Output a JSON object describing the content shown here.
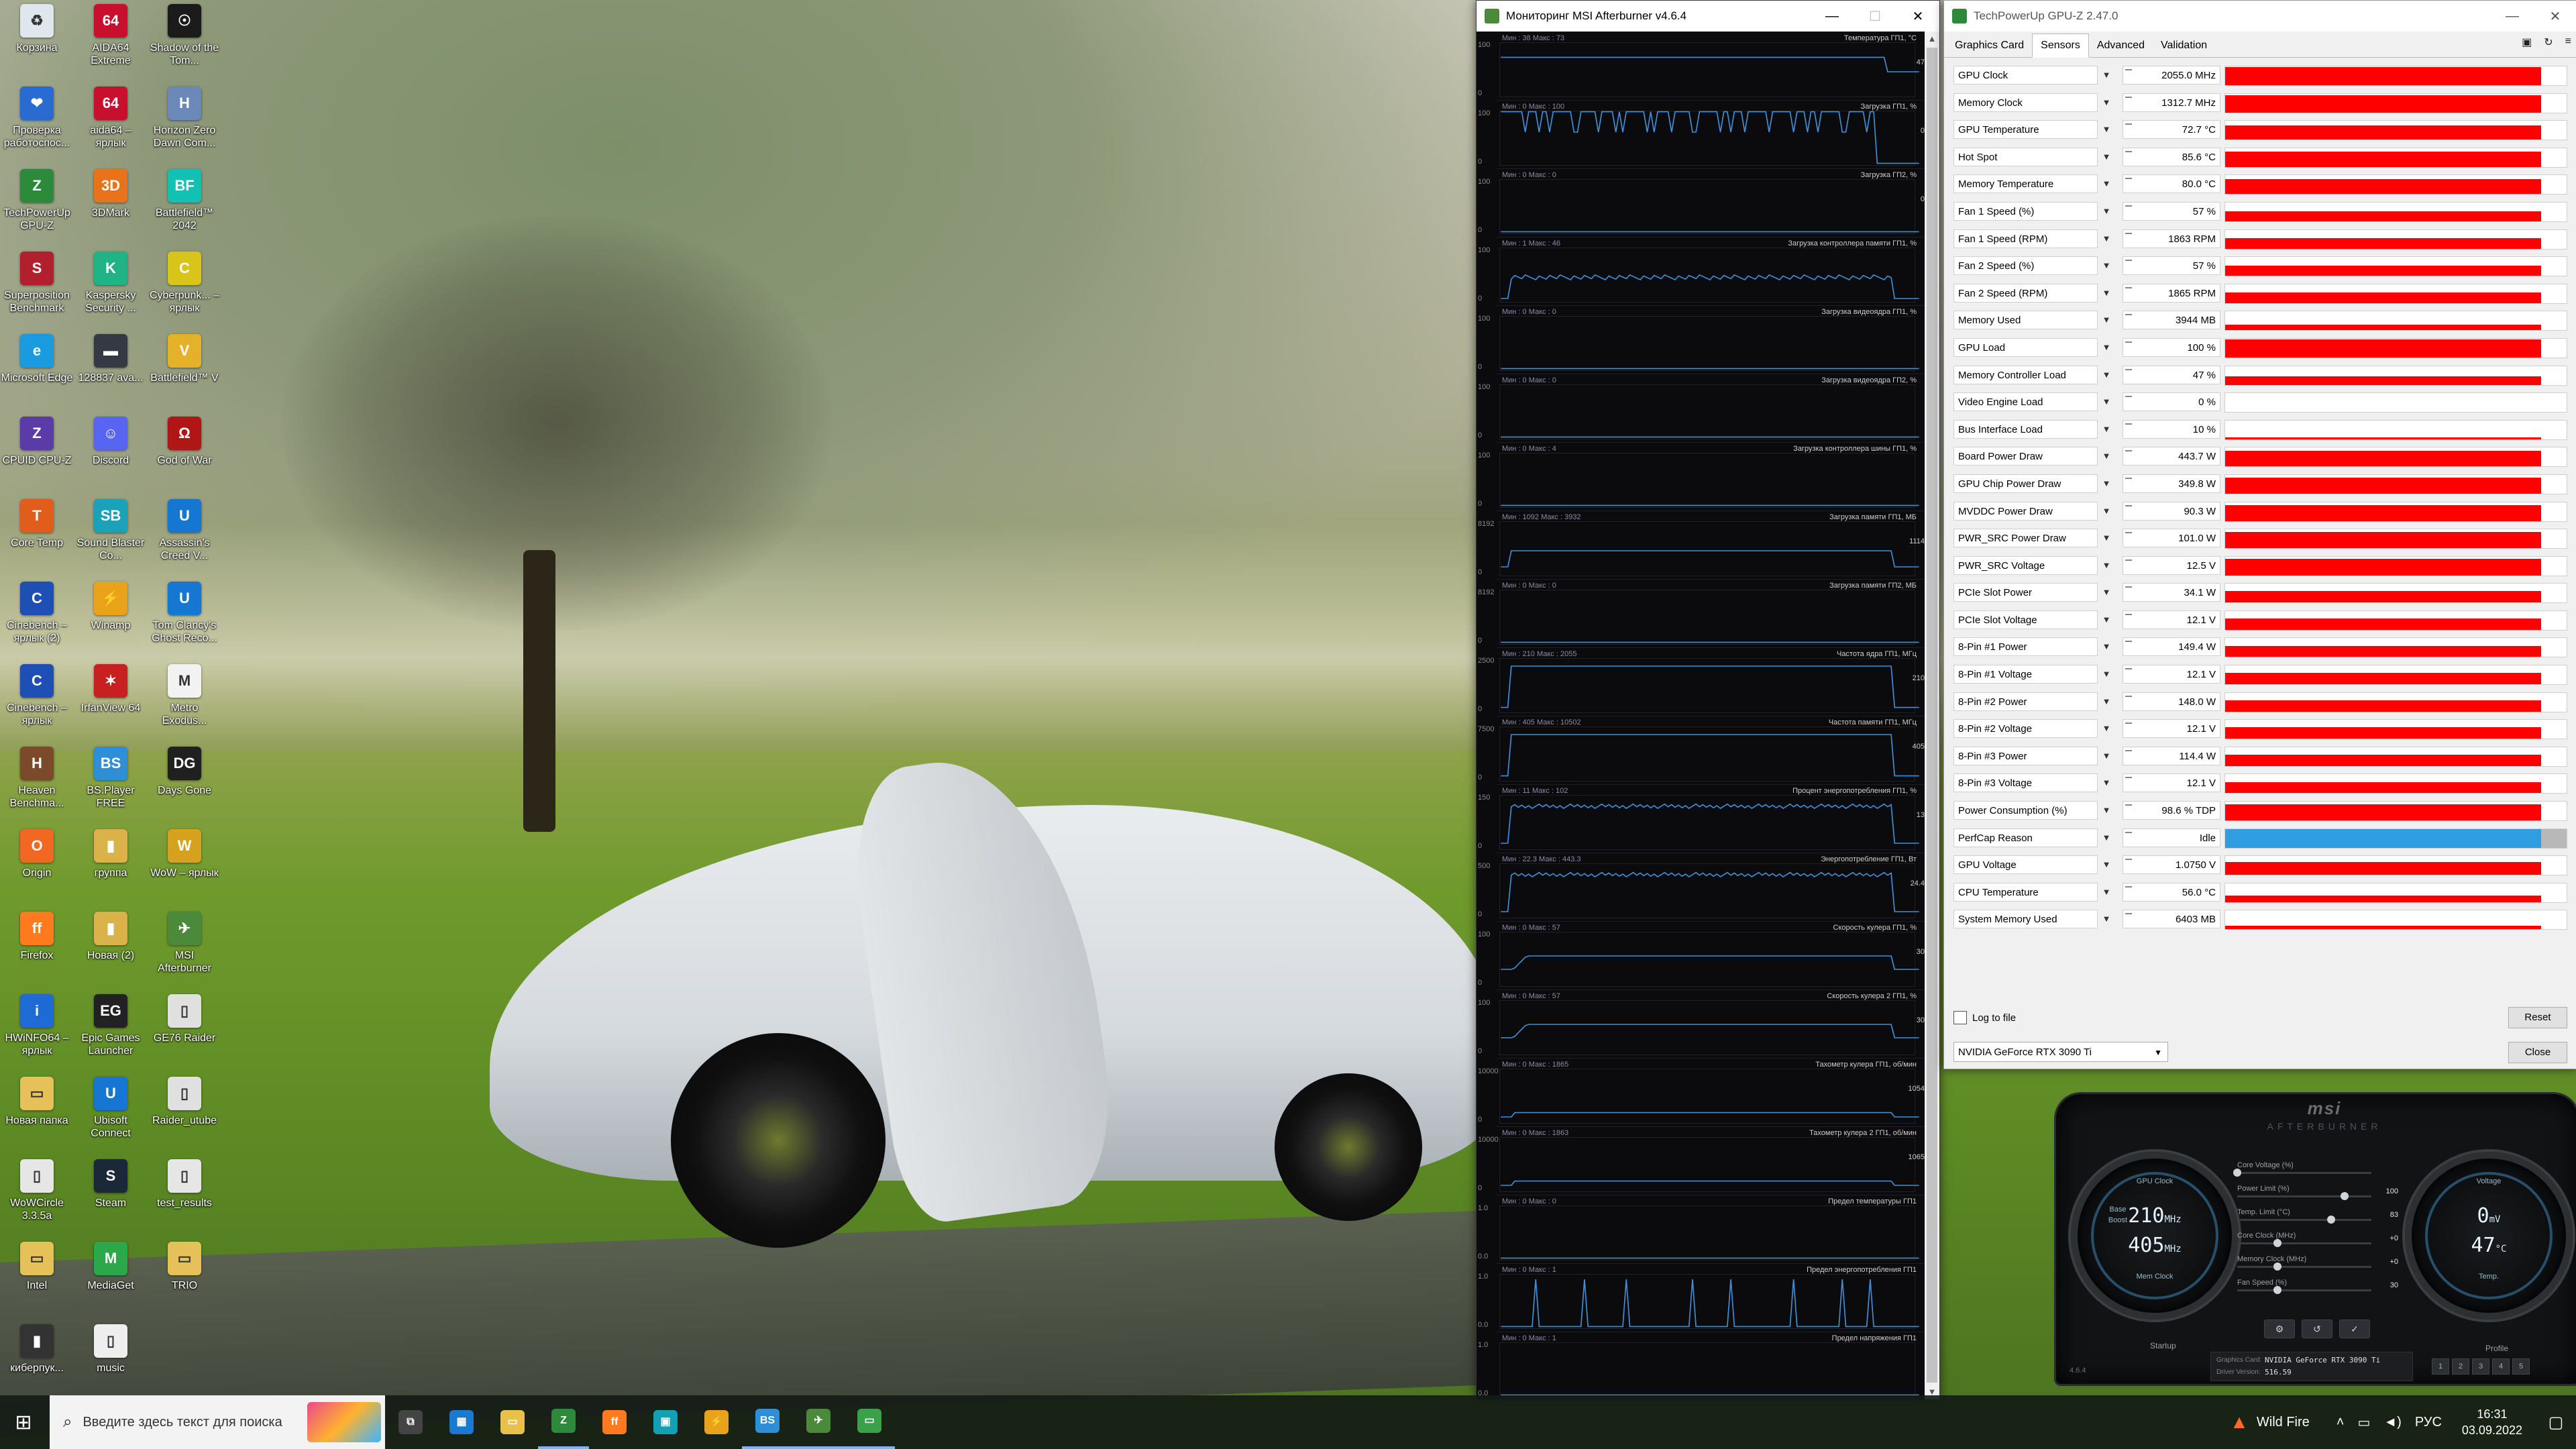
{
  "desktop": {
    "icons": [
      {
        "label": "Корзина",
        "color": "#dfe6ee",
        "symbol": "♻"
      },
      {
        "label": "AIDA64 Extreme",
        "color": "#c8102e",
        "symbol": "64"
      },
      {
        "label": "Shadow of the Tom...",
        "color": "#1b1b1b",
        "symbol": "☉"
      },
      {
        "label": "Проверка работоспос...",
        "color": "#2a6bd1",
        "symbol": "❤"
      },
      {
        "label": "aida64 – ярлык",
        "color": "#c8102e",
        "symbol": "64"
      },
      {
        "label": "Horizon Zero Dawn Com...",
        "color": "#6a88b8",
        "symbol": "H"
      },
      {
        "label": "TechPowerUp GPU-Z",
        "color": "#2c8a3a",
        "symbol": "Z"
      },
      {
        "label": "3DMark",
        "color": "#e8731a",
        "symbol": "3D"
      },
      {
        "label": "Battlefield™ 2042",
        "color": "#11c2b2",
        "symbol": "BF"
      },
      {
        "label": "Superposition Benchmark",
        "color": "#b21f2d",
        "symbol": "S"
      },
      {
        "label": "Kaspersky Security ...",
        "color": "#1fb386",
        "symbol": "K"
      },
      {
        "label": "Cyberpunk... – ярлык",
        "color": "#d9c41a",
        "symbol": "C"
      },
      {
        "label": "Microsoft Edge",
        "color": "#1a9be0",
        "symbol": "e"
      },
      {
        "label": "128837 ava...",
        "color": "#333a44",
        "symbol": "▬"
      },
      {
        "label": "Battlefield™ V",
        "color": "#e5b02a",
        "symbol": "V"
      },
      {
        "label": "CPUID CPU-Z",
        "color": "#5b3ba8",
        "symbol": "Z"
      },
      {
        "label": "Discord",
        "color": "#5865f2",
        "symbol": "☺"
      },
      {
        "label": "God of War",
        "color": "#b01616",
        "symbol": "Ω"
      },
      {
        "label": "Core Temp",
        "color": "#e25c1b",
        "symbol": "T"
      },
      {
        "label": "Sound Blaster Co...",
        "color": "#1aa3b8",
        "symbol": "SB"
      },
      {
        "label": "Assassin's Creed V...",
        "color": "#1677d2",
        "symbol": "U"
      },
      {
        "label": "Cinebench – ярлык (2)",
        "color": "#1e4fb5",
        "symbol": "C"
      },
      {
        "label": "Winamp",
        "color": "#e8a31a",
        "symbol": "⚡"
      },
      {
        "label": "Tom Clancy's Ghost Reco...",
        "color": "#1677d2",
        "symbol": "U"
      },
      {
        "label": "Cinebench – ярлык",
        "color": "#1e4fb5",
        "symbol": "C"
      },
      {
        "label": "IrfanView 64",
        "color": "#c82020",
        "symbol": "✶"
      },
      {
        "label": "Metro Exodus...",
        "color": "#f2f2f2",
        "symbol": "M"
      },
      {
        "label": "Heaven Benchma...",
        "color": "#7a4a2a",
        "symbol": "H"
      },
      {
        "label": "BS.Player FREE",
        "color": "#2f8fd6",
        "symbol": "BS"
      },
      {
        "label": "Days Gone",
        "color": "#202020",
        "symbol": "DG"
      },
      {
        "label": "Origin",
        "color": "#f26722",
        "symbol": "O"
      },
      {
        "label": "группа",
        "color": "#d9b24a",
        "symbol": "▮"
      },
      {
        "label": "WoW – ярлык",
        "color": "#d6a21e",
        "symbol": "W"
      },
      {
        "label": "Firefox",
        "color": "#ff7a1f",
        "symbol": "ff"
      },
      {
        "label": "Новая (2)",
        "color": "#d9b24a",
        "symbol": "▮"
      },
      {
        "label": "MSI Afterburner",
        "color": "#4a8a3a",
        "symbol": "✈"
      },
      {
        "label": "HWiNFO64 – ярлык",
        "color": "#1e6bd6",
        "symbol": "i"
      },
      {
        "label": "Epic Games Launcher",
        "color": "#222222",
        "symbol": "EG"
      },
      {
        "label": "GE76 Raider",
        "color": "#e0e0e0",
        "symbol": "▯"
      },
      {
        "label": "Новая папка",
        "color": "#e6c15a",
        "symbol": "▭"
      },
      {
        "label": "Ubisoft Connect",
        "color": "#1677d2",
        "symbol": "U"
      },
      {
        "label": "Raider_utube",
        "color": "#e0e0e0",
        "symbol": "▯"
      },
      {
        "label": "WoWCircle 3.3.5a",
        "color": "#e6e6e6",
        "symbol": "▯"
      },
      {
        "label": "Steam",
        "color": "#1b2838",
        "symbol": "S"
      },
      {
        "label": "test_results",
        "color": "#e6e6e6",
        "symbol": "▯"
      },
      {
        "label": "Intel",
        "color": "#e6c15a",
        "symbol": "▭"
      },
      {
        "label": "MediaGet",
        "color": "#2aa84a",
        "symbol": "M"
      },
      {
        "label": "TRIO",
        "color": "#e6c15a",
        "symbol": "▭"
      },
      {
        "label": "киберпук...",
        "color": "#333333",
        "symbol": "▮"
      },
      {
        "label": "music",
        "color": "#eeeeee",
        "symbol": "▯"
      }
    ]
  },
  "monitor": {
    "title": "Мониторинг MSI Afterburner v4.6.4",
    "accent": "#3f8fd8",
    "graphs": [
      {
        "name": "Температура ГП1, °С",
        "minmax": "Мин : 38  Макс : 73",
        "scale_top": "100",
        "scale_bottom": "0",
        "value": "47",
        "shape": "step-high"
      },
      {
        "name": "Загрузка ГП1, %",
        "minmax": "Мин : 0  Макс : 100",
        "scale_top": "100",
        "scale_bottom": "0",
        "value": "0",
        "shape": "spiky"
      },
      {
        "name": "Загрузка ГП2, %",
        "minmax": "Мин : 0  Макс : 0",
        "scale_top": "100",
        "scale_bottom": "0",
        "value": "0",
        "shape": "flat"
      },
      {
        "name": "Загрузка контроллера памяти ГП1, %",
        "minmax": "Мин : 1  Макс : 46",
        "scale_top": "100",
        "scale_bottom": "0",
        "value": "",
        "shape": "mid-noisy"
      },
      {
        "name": "Загрузка видеоядра ГП1, %",
        "minmax": "Мин : 0  Макс : 0",
        "scale_top": "100",
        "scale_bottom": "0",
        "value": "",
        "shape": "flat"
      },
      {
        "name": "Загрузка видеоядра ГП2, %",
        "minmax": "Мин : 0  Макс : 0",
        "scale_top": "100",
        "scale_bottom": "0",
        "value": "",
        "shape": "flat"
      },
      {
        "name": "Загрузка контроллера шины ГП1, %",
        "minmax": "Мин : 0  Макс : 4",
        "scale_top": "100",
        "scale_bottom": "0",
        "value": "",
        "shape": "flat"
      },
      {
        "name": "Загрузка памяти ГП1, МБ",
        "minmax": "Мин : 1092  Макс : 3932",
        "scale_top": "8192",
        "scale_bottom": "0",
        "value": "1114",
        "shape": "low-plateau"
      },
      {
        "name": "Загрузка памяти ГП2, МБ",
        "minmax": "Мин : 0  Макс : 0",
        "scale_top": "8192",
        "scale_bottom": "0",
        "value": "",
        "shape": "flat"
      },
      {
        "name": "Частота ядра ГП1, МГц",
        "minmax": "Мин : 210  Макс : 2055",
        "scale_top": "2500",
        "scale_bottom": "0",
        "value": "210",
        "shape": "block"
      },
      {
        "name": "Частота памяти ГП1, МГц",
        "minmax": "Мин : 405  Макс : 10502",
        "scale_top": "7500",
        "scale_bottom": "0",
        "value": "405",
        "shape": "block"
      },
      {
        "name": "Процент энергопотребления ГП1, %",
        "minmax": "Мин : 11  Макс : 102",
        "scale_top": "150",
        "scale_bottom": "0",
        "value": "13",
        "shape": "block-noisy"
      },
      {
        "name": "Энергопотребление ГП1, Вт",
        "minmax": "Мин : 22.3  Макс : 443.3",
        "scale_top": "500",
        "scale_bottom": "0",
        "value": "24.4",
        "shape": "block-noisy"
      },
      {
        "name": "Скорость кулера ГП1, %",
        "minmax": "Мин : 0  Макс : 57",
        "scale_top": "100",
        "scale_bottom": "0",
        "value": "30",
        "shape": "fan"
      },
      {
        "name": "Скорость кулера 2 ГП1, %",
        "minmax": "Мин : 0  Макс : 57",
        "scale_top": "100",
        "scale_bottom": "0",
        "value": "30",
        "shape": "fan"
      },
      {
        "name": "Тахометр кулера ГП1, об/мин",
        "minmax": "Мин : 0  Макс : 1865",
        "scale_top": "10000",
        "scale_bottom": "0",
        "value": "1054",
        "shape": "fan-low"
      },
      {
        "name": "Тахометр кулера 2 ГП1, об/мин",
        "minmax": "Мин : 0  Макс : 1863",
        "scale_top": "10000",
        "scale_bottom": "0",
        "value": "1065",
        "shape": "fan-low"
      },
      {
        "name": "Предел температуры ГП1",
        "minmax": "Мин : 0  Макс : 0",
        "scale_top": "1.0",
        "scale_bottom": "0.0",
        "value": "",
        "shape": "flat"
      },
      {
        "name": "Предел энергопотребления ГП1",
        "minmax": "Мин : 0  Макс : 1",
        "scale_top": "1.0",
        "scale_bottom": "0.0",
        "value": "",
        "shape": "pulses"
      },
      {
        "name": "Предел напряжения ГП1",
        "minmax": "Мин : 0  Макс : 1",
        "scale_top": "1.0",
        "scale_bottom": "0.0",
        "value": "",
        "shape": "flat"
      }
    ]
  },
  "gpuz": {
    "title": "TechPowerUp GPU-Z 2.47.0",
    "tabs": [
      "Graphics Card",
      "Sensors",
      "Advanced",
      "Validation"
    ],
    "active_tab": "Sensors",
    "tools": [
      "camera-icon",
      "refresh-icon",
      "menu-icon"
    ],
    "sensor_color": "#ff0000",
    "perfcap_color": "#2f9de0",
    "sensors": [
      {
        "name": "GPU Clock",
        "value": "2055.0 MHz",
        "level": 0.97
      },
      {
        "name": "Memory Clock",
        "value": "1312.7 MHz",
        "level": 0.9
      },
      {
        "name": "GPU Temperature",
        "value": "72.7 °C",
        "level": 0.75
      },
      {
        "name": "Hot Spot",
        "value": "85.6 °C",
        "level": 0.8
      },
      {
        "name": "Memory Temperature",
        "value": "80.0 °C",
        "level": 0.8
      },
      {
        "name": "Fan 1 Speed (%)",
        "value": "57 %",
        "level": 0.55
      },
      {
        "name": "Fan 1 Speed (RPM)",
        "value": "1863 RPM",
        "level": 0.55
      },
      {
        "name": "Fan 2 Speed (%)",
        "value": "57 %",
        "level": 0.55
      },
      {
        "name": "Fan 2 Speed (RPM)",
        "value": "1865 RPM",
        "level": 0.55
      },
      {
        "name": "Memory Used",
        "value": "3944 MB",
        "level": 0.3
      },
      {
        "name": "GPU Load",
        "value": "100 %",
        "level": 0.95
      },
      {
        "name": "Memory Controller Load",
        "value": "47 %",
        "level": 0.45
      },
      {
        "name": "Video Engine Load",
        "value": "0 %",
        "level": 0.0
      },
      {
        "name": "Bus Interface Load",
        "value": "10 %",
        "level": 0.1
      },
      {
        "name": "Board Power Draw",
        "value": "443.7 W",
        "level": 0.85
      },
      {
        "name": "GPU Chip Power Draw",
        "value": "349.8 W",
        "level": 0.85
      },
      {
        "name": "MVDDC Power Draw",
        "value": "90.3 W",
        "level": 0.85
      },
      {
        "name": "PWR_SRC Power Draw",
        "value": "101.0 W",
        "level": 0.85
      },
      {
        "name": "PWR_SRC Voltage",
        "value": "12.5 V",
        "level": 0.9
      },
      {
        "name": "PCIe Slot Power",
        "value": "34.1 W",
        "level": 0.6
      },
      {
        "name": "PCIe Slot Voltage",
        "value": "12.1 V",
        "level": 0.6
      },
      {
        "name": "8-Pin #1 Power",
        "value": "149.4 W",
        "level": 0.6
      },
      {
        "name": "8-Pin #1 Voltage",
        "value": "12.1 V",
        "level": 0.6
      },
      {
        "name": "8-Pin #2 Power",
        "value": "148.0 W",
        "level": 0.6
      },
      {
        "name": "8-Pin #2 Voltage",
        "value": "12.1 V",
        "level": 0.6
      },
      {
        "name": "8-Pin #3 Power",
        "value": "114.4 W",
        "level": 0.6
      },
      {
        "name": "8-Pin #3 Voltage",
        "value": "12.1 V",
        "level": 0.6
      },
      {
        "name": "Power Consumption (%)",
        "value": "98.6 % TDP",
        "level": 0.85
      },
      {
        "name": "PerfCap Reason",
        "value": "Idle",
        "level": 0.7
      },
      {
        "name": "GPU Voltage",
        "value": "1.0750 V",
        "level": 0.7
      },
      {
        "name": "CPU Temperature",
        "value": "56.0 °C",
        "level": 0.35
      },
      {
        "name": "System Memory Used",
        "value": "6403 MB",
        "level": 0.2
      }
    ],
    "log_to_file": "Log to file",
    "reset": "Reset",
    "gpu_select": "NVIDIA GeForce RTX 3090 Ti",
    "close": "Close"
  },
  "afterburner": {
    "brand": "AFTERBURNER",
    "logo": "msi",
    "left_dial": {
      "top_label": "GPU Clock",
      "base_label": "Base",
      "boost_label": "Boost",
      "core": "210",
      "core_unit": "MHz",
      "mem": "405",
      "mem_unit": "MHz",
      "bottom_label": "Mem Clock"
    },
    "right_dial": {
      "top_label": "Voltage",
      "voltage": "0",
      "voltage_unit": "mV",
      "temp": "47",
      "temp_unit": "°C",
      "bottom_label": "Temp."
    },
    "sliders": [
      {
        "label": "Core Voltage (%)",
        "value": "",
        "level": 0.0
      },
      {
        "label": "Power Limit (%)",
        "value": "100",
        "level": 0.8
      },
      {
        "label": "Temp. Limit (°C)",
        "value": "83",
        "level": 0.7
      },
      {
        "label": "Core Clock (MHz)",
        "value": "+0",
        "level": 0.3
      },
      {
        "label": "Memory Clock (MHz)",
        "value": "+0",
        "level": 0.3
      },
      {
        "label": "Fan Speed (%)",
        "value": "30",
        "level": 0.3
      }
    ],
    "card_label": "Graphics Card:",
    "card_value": "NVIDIA GeForce RTX 3090 Ti",
    "driver_label": "Driver Version:",
    "driver_value": "516.59",
    "startup": "Startup",
    "profile": "Profile",
    "version": "4.6.4",
    "profiles": [
      "1",
      "2",
      "3",
      "4",
      "5"
    ]
  },
  "taskbar": {
    "search_placeholder": "Введите здесь текст для поиска",
    "apps": [
      {
        "name": "task-view",
        "color": "#444444",
        "symbol": "⧉"
      },
      {
        "name": "calculator",
        "color": "#1b7ad0",
        "symbol": "▦"
      },
      {
        "name": "file-explorer",
        "color": "#e9c04a",
        "symbol": "▭"
      },
      {
        "name": "gpu-z",
        "color": "#2c8a3a",
        "symbol": "Z"
      },
      {
        "name": "firefox",
        "color": "#ff7a1f",
        "symbol": "ff"
      },
      {
        "name": "media",
        "color": "#14a0b4",
        "symbol": "▣"
      },
      {
        "name": "winamp",
        "color": "#e8a31a",
        "symbol": "⚡"
      },
      {
        "name": "bsplayer",
        "color": "#2f8fd6",
        "symbol": "BS"
      },
      {
        "name": "msi-afterburner",
        "color": "#4a8a3a",
        "symbol": "✈"
      },
      {
        "name": "monitor",
        "color": "#3aa04a",
        "symbol": "▭"
      }
    ],
    "weather": "Wild Fire",
    "lang": "РУС",
    "time": "16:31",
    "date": "03.09.2022"
  }
}
